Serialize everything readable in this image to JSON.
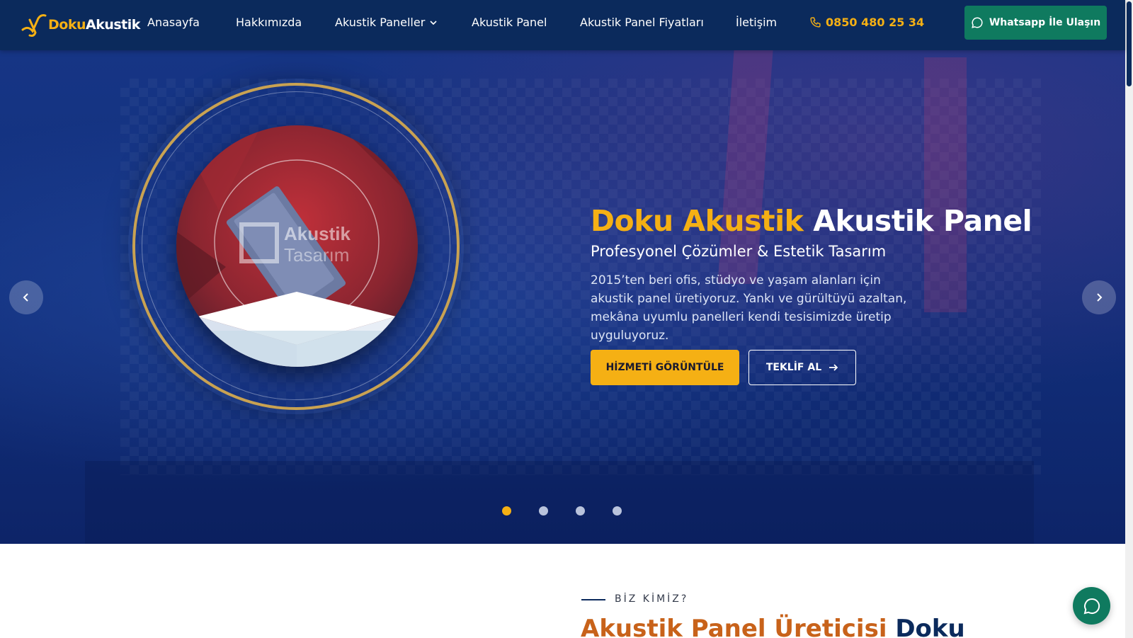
{
  "brand": {
    "name_part1": "Doku",
    "name_part2": "Akustik"
  },
  "nav": {
    "items": [
      {
        "label": "Anasayfa"
      },
      {
        "label": "Hakkımızda"
      },
      {
        "label": "Akustik Paneller"
      },
      {
        "label": "Akustik Panel"
      },
      {
        "label": "Akustik Panel Fiyatları"
      },
      {
        "label": "İletişim"
      }
    ],
    "phone": "0850 480 25 34",
    "whatsapp_label": "Whatsapp İle Ulaşın"
  },
  "hero": {
    "title_accent": "Doku Akustik",
    "title_rest": "Akustik Panel",
    "subtitle": "Profesyonel Çözümler & Estetik Tasarım",
    "description": "2015’ten beri ofis, stüdyo ve yaşam alanları için akustik panel üretiyoruz. Yankı ve gürültüyü azaltan, mekâna uyumlu panelleri kendi tesisimizde üretip uyguluyoruz.",
    "primary_button": "HİZMETİ GÖRÜNTÜLE",
    "secondary_button": "TEKLİF AL",
    "image_watermark_line1": "Akustik",
    "image_watermark_line2": "Tasarım",
    "slides_count": 4,
    "active_slide": 1
  },
  "about": {
    "eyebrow": "BİZ KİMİZ?",
    "title_accent": "Akustik Panel Üreticisi",
    "title_rest": "Doku"
  },
  "colors": {
    "header_bg": "#0b2a5c",
    "accent_yellow": "#f5b014",
    "whatsapp_green": "#0f7a5f",
    "about_title_orange": "#c8621a"
  },
  "icons": {
    "phone": "phone-icon",
    "whatsapp": "whatsapp-icon",
    "chevron": "chevron-down-icon",
    "arrow_right": "arrow-right-icon",
    "prev": "chevron-left-icon",
    "next": "chevron-right-icon",
    "chat": "chat-bubble-icon"
  }
}
